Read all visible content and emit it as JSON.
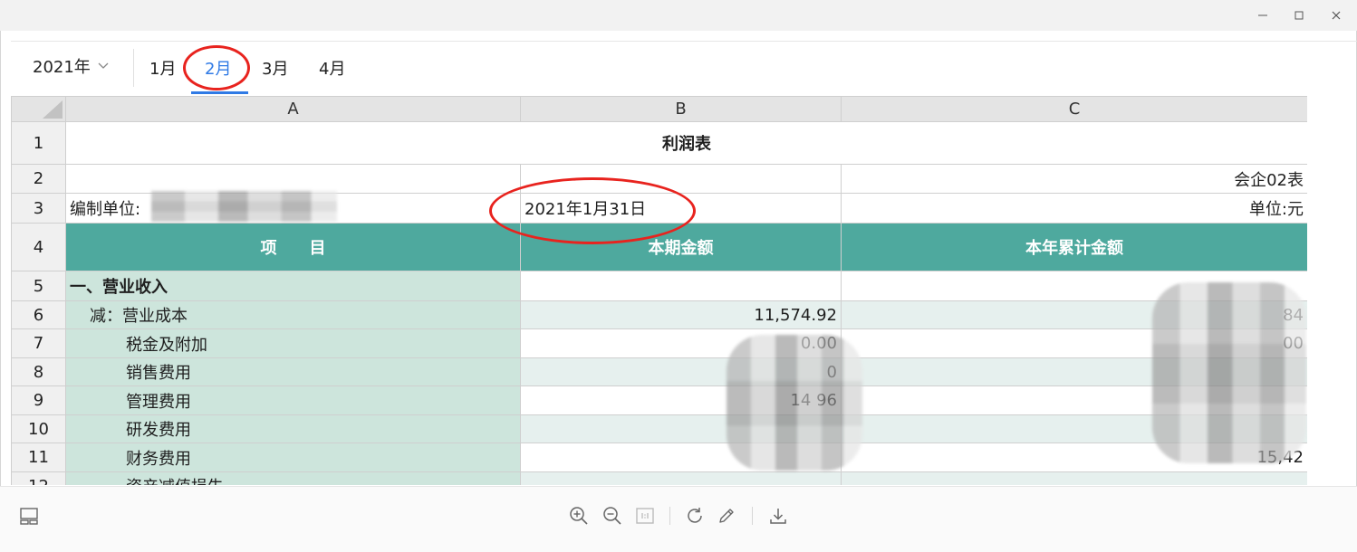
{
  "window": {
    "controls": [
      "minimize-icon",
      "maximize-icon",
      "close-icon"
    ]
  },
  "toolbar": {
    "year_value": "2021年",
    "months": [
      "1月",
      "2月",
      "3月",
      "4月"
    ],
    "active_month": "2月",
    "accent_color": "#2f7ae5"
  },
  "sheet": {
    "column_headers": [
      "A",
      "B",
      "C"
    ],
    "row_numbers": [
      "1",
      "2",
      "3",
      "4",
      "5",
      "6",
      "7",
      "8",
      "9",
      "10",
      "11",
      "12"
    ],
    "title": "利润表",
    "form_code": "会企02表",
    "org_label": "编制单位:",
    "date": "2021年1月31日",
    "unit": "单位:元",
    "header": {
      "item": "项　　目",
      "current": "本期金额",
      "ytd": "本年累计金额"
    },
    "rows": [
      {
        "item": "一、营业收入",
        "current": "",
        "ytd": ""
      },
      {
        "item": "减：营业成本",
        "current": "11,574.92",
        "ytd": "84"
      },
      {
        "item": "税金及附加",
        "current": "0.00",
        "ytd": "00"
      },
      {
        "item": "销售费用",
        "current": "0",
        "ytd": ""
      },
      {
        "item": "管理费用",
        "current": "14 96",
        "ytd": ""
      },
      {
        "item": "研发费用",
        "current": "",
        "ytd": ""
      },
      {
        "item": "财务费用",
        "current": "",
        "ytd": "15,42"
      },
      {
        "item": "资产减值损失",
        "current": "",
        "ytd": ""
      }
    ],
    "teal_color": "#4ea99e",
    "item_bg_color": "#cde5dc"
  },
  "statusbar": {
    "icons": [
      "layout-icon",
      "zoom-in-icon",
      "zoom-out-icon",
      "actual-size-icon",
      "rotate-icon",
      "edit-icon",
      "download-icon"
    ]
  },
  "annotation_color": "#e8231e"
}
